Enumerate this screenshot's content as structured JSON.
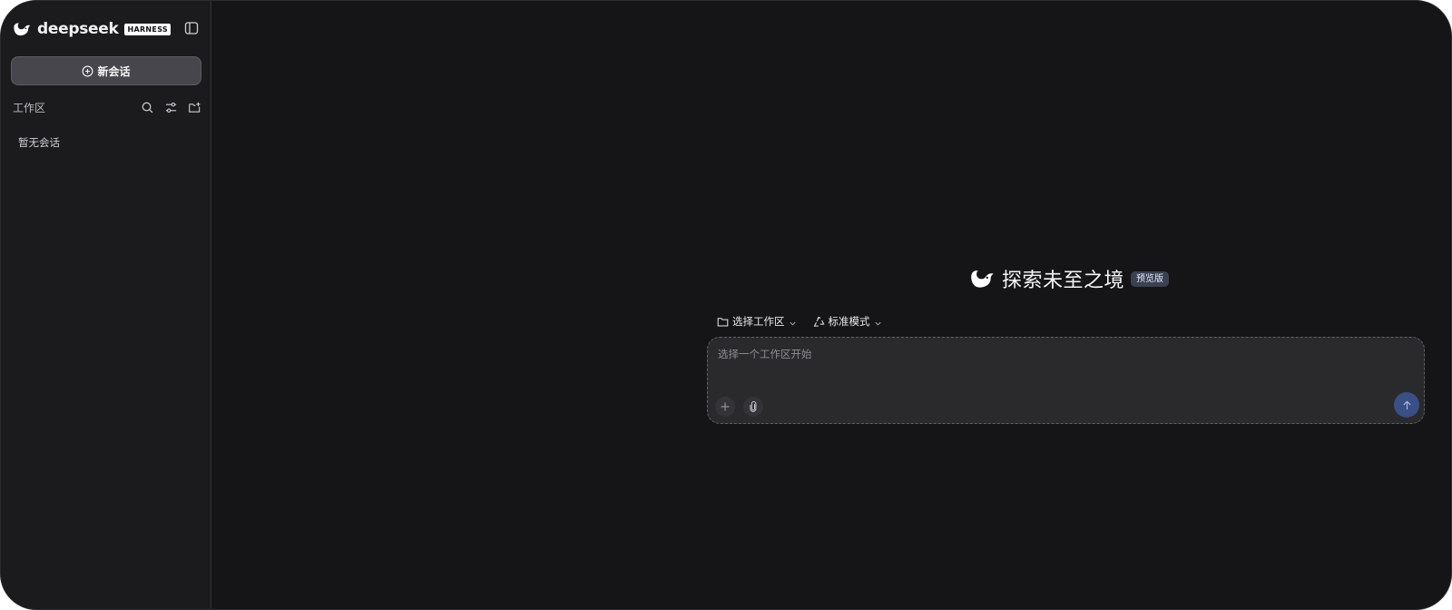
{
  "sidebar": {
    "brand_name": "deepseek",
    "brand_tag": "HARNESS",
    "new_chat_label": "新会话",
    "workspace_label": "工作区",
    "empty_text": "暂无会话"
  },
  "main": {
    "hero_title": "探索未至之境",
    "hero_badge": "预览版",
    "workspace_select_label": "选择工作区",
    "mode_select_label": "标准模式",
    "composer_placeholder": "选择一个工作区开始"
  },
  "colors": {
    "background": "#151517",
    "sidebar": "#1b1b1d",
    "new_chat_button": "#46464c",
    "composer": "#2a2a2d",
    "send_button": "#3a4f85",
    "badge": "#3a4150"
  },
  "icons": {
    "brand": "whale-logo-icon",
    "collapse": "sidebar-toggle-icon",
    "new_chat": "plus-circle-icon",
    "search": "search-icon",
    "filter": "sliders-icon",
    "new_folder": "folder-plus-icon",
    "workspace": "folder-icon",
    "mode": "recycle-icon",
    "add": "plus-icon",
    "attach": "paperclip-icon",
    "send": "arrow-up-icon"
  }
}
